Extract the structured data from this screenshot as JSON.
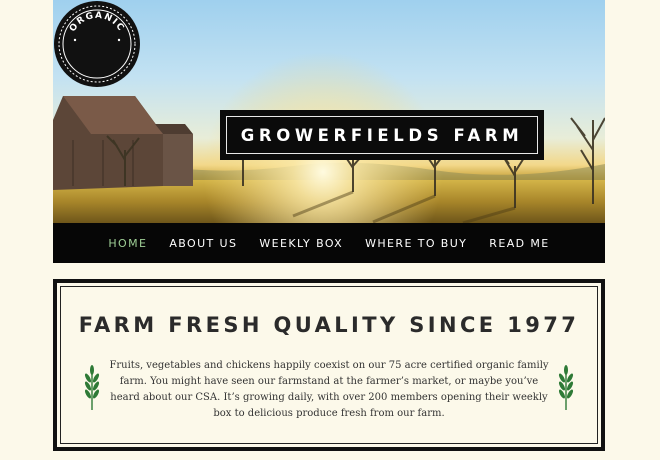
{
  "site": {
    "badge_text": "ORGANIC",
    "logo_text": "GROWERFIELDS FARM"
  },
  "nav": {
    "items": [
      {
        "label": "HOME",
        "active": true
      },
      {
        "label": "ABOUT US",
        "active": false
      },
      {
        "label": "WEEKLY BOX",
        "active": false
      },
      {
        "label": "WHERE TO BUY",
        "active": false
      },
      {
        "label": "READ ME",
        "active": false
      }
    ]
  },
  "main": {
    "headline": "FARM FRESH QUALITY SINCE 1977",
    "body": "Fruits, vegetables and chickens happily coexist on our 75 acre certified organic family farm. You might have seen our farmstand at the farmer’s market, or maybe you’ve heard about our CSA.  It’s growing daily, with over 200 members opening their weekly box to delicious produce fresh from our farm.",
    "icons": [
      "wheat-icon",
      "wheat-icon"
    ]
  },
  "colors": {
    "background": "#fcf9ea",
    "nav_background": "#060606",
    "nav_active": "#9fcf96",
    "wheat": "#2e7a36"
  }
}
